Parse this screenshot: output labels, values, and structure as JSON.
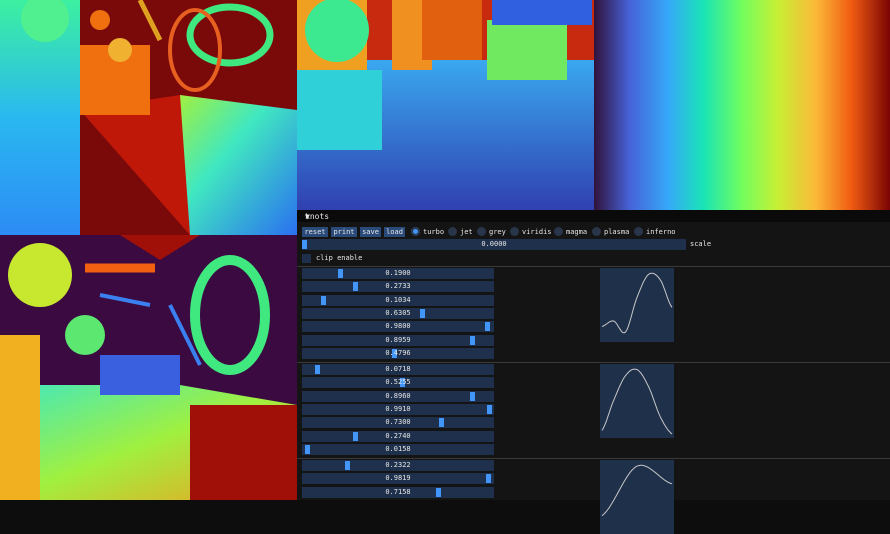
{
  "colors": {
    "accent": "#4296fa",
    "frame": "#1e304b",
    "button": "#2a4a7a",
    "plot_bg": "#1f304a"
  },
  "panel": {
    "title": "knots",
    "collapse_glyph": "▼",
    "buttons": [
      "reset",
      "print",
      "save",
      "load"
    ],
    "colormaps": [
      "turbo",
      "jet",
      "grey",
      "viridis",
      "magma",
      "plasma",
      "inferno"
    ],
    "selected_colormap": "turbo",
    "scale": {
      "value": "0.0000",
      "label": "scale",
      "fraction": 0.0
    },
    "clip_label": "clip enable",
    "groups": [
      {
        "values": [
          "0.1900",
          "0.2733",
          "0.1034",
          "0.6305",
          "0.9800",
          "0.8959",
          "0.4796"
        ],
        "fractions": [
          0.19,
          0.2733,
          0.1034,
          0.6305,
          0.98,
          0.8959,
          0.4796
        ]
      },
      {
        "values": [
          "0.0718",
          "0.5255",
          "0.8960",
          "0.9910",
          "0.7300",
          "0.2740",
          "0.0158"
        ],
        "fractions": [
          0.0718,
          0.5255,
          0.896,
          0.991,
          0.73,
          0.274,
          0.0158
        ]
      },
      {
        "values": [
          "0.2322",
          "0.9819",
          "0.7158"
        ],
        "fractions": [
          0.2322,
          0.9819,
          0.7158
        ]
      }
    ]
  }
}
